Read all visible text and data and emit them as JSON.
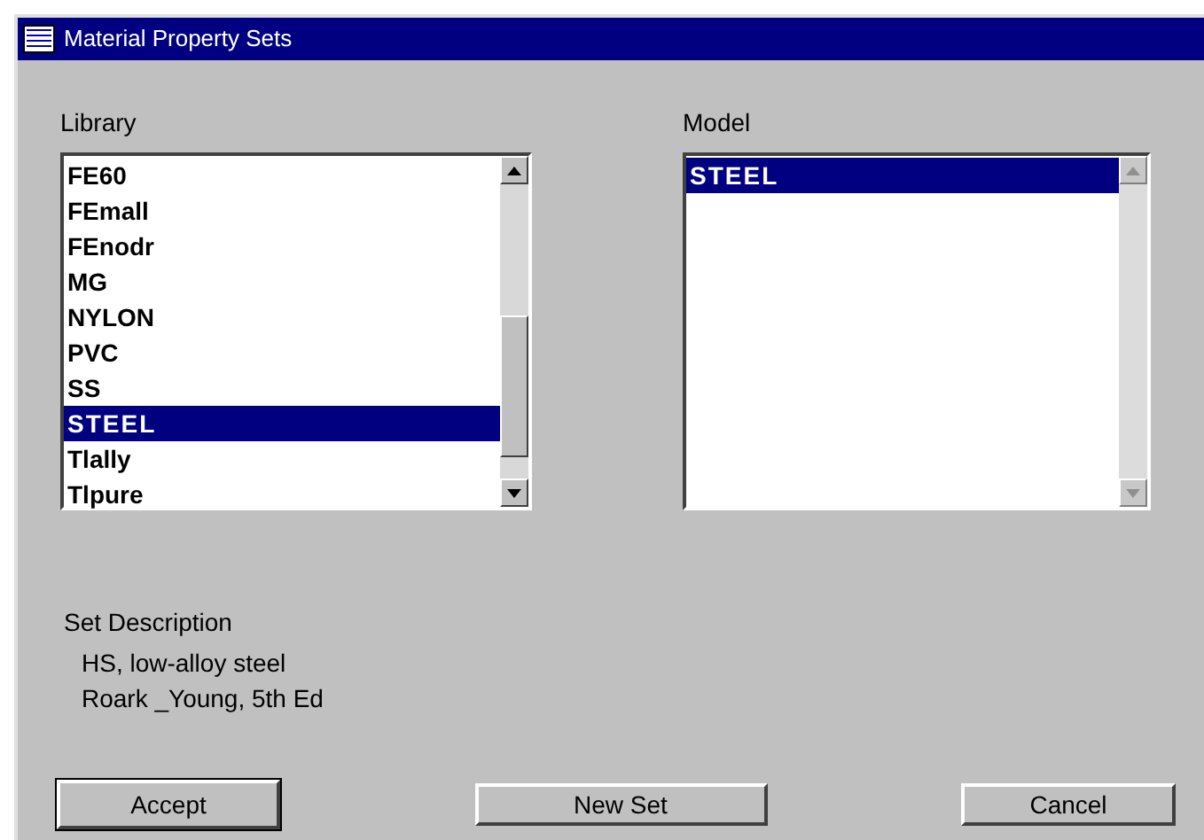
{
  "window": {
    "title": "Material Property Sets"
  },
  "library": {
    "label": "Library",
    "items": [
      {
        "text": "FE60",
        "selected": false
      },
      {
        "text": "FEmall",
        "selected": false
      },
      {
        "text": "FEnodr",
        "selected": false
      },
      {
        "text": "MG",
        "selected": false
      },
      {
        "text": "NYLON",
        "selected": false
      },
      {
        "text": "PVC",
        "selected": false
      },
      {
        "text": "SS",
        "selected": false
      },
      {
        "text": "STEEL",
        "selected": true
      },
      {
        "text": "Tlally",
        "selected": false
      },
      {
        "text": "Tlpure",
        "selected": false
      }
    ]
  },
  "model": {
    "label": "Model",
    "items": [
      {
        "text": "STEEL",
        "selected": true
      }
    ]
  },
  "set_description": {
    "label": "Set Description",
    "lines": [
      "HS, low-alloy steel",
      "Roark _Young, 5th Ed"
    ]
  },
  "buttons": [
    {
      "label": "Accept",
      "default": true
    },
    {
      "label": "New Set",
      "default": false
    },
    {
      "label": "Cancel",
      "default": false
    }
  ]
}
